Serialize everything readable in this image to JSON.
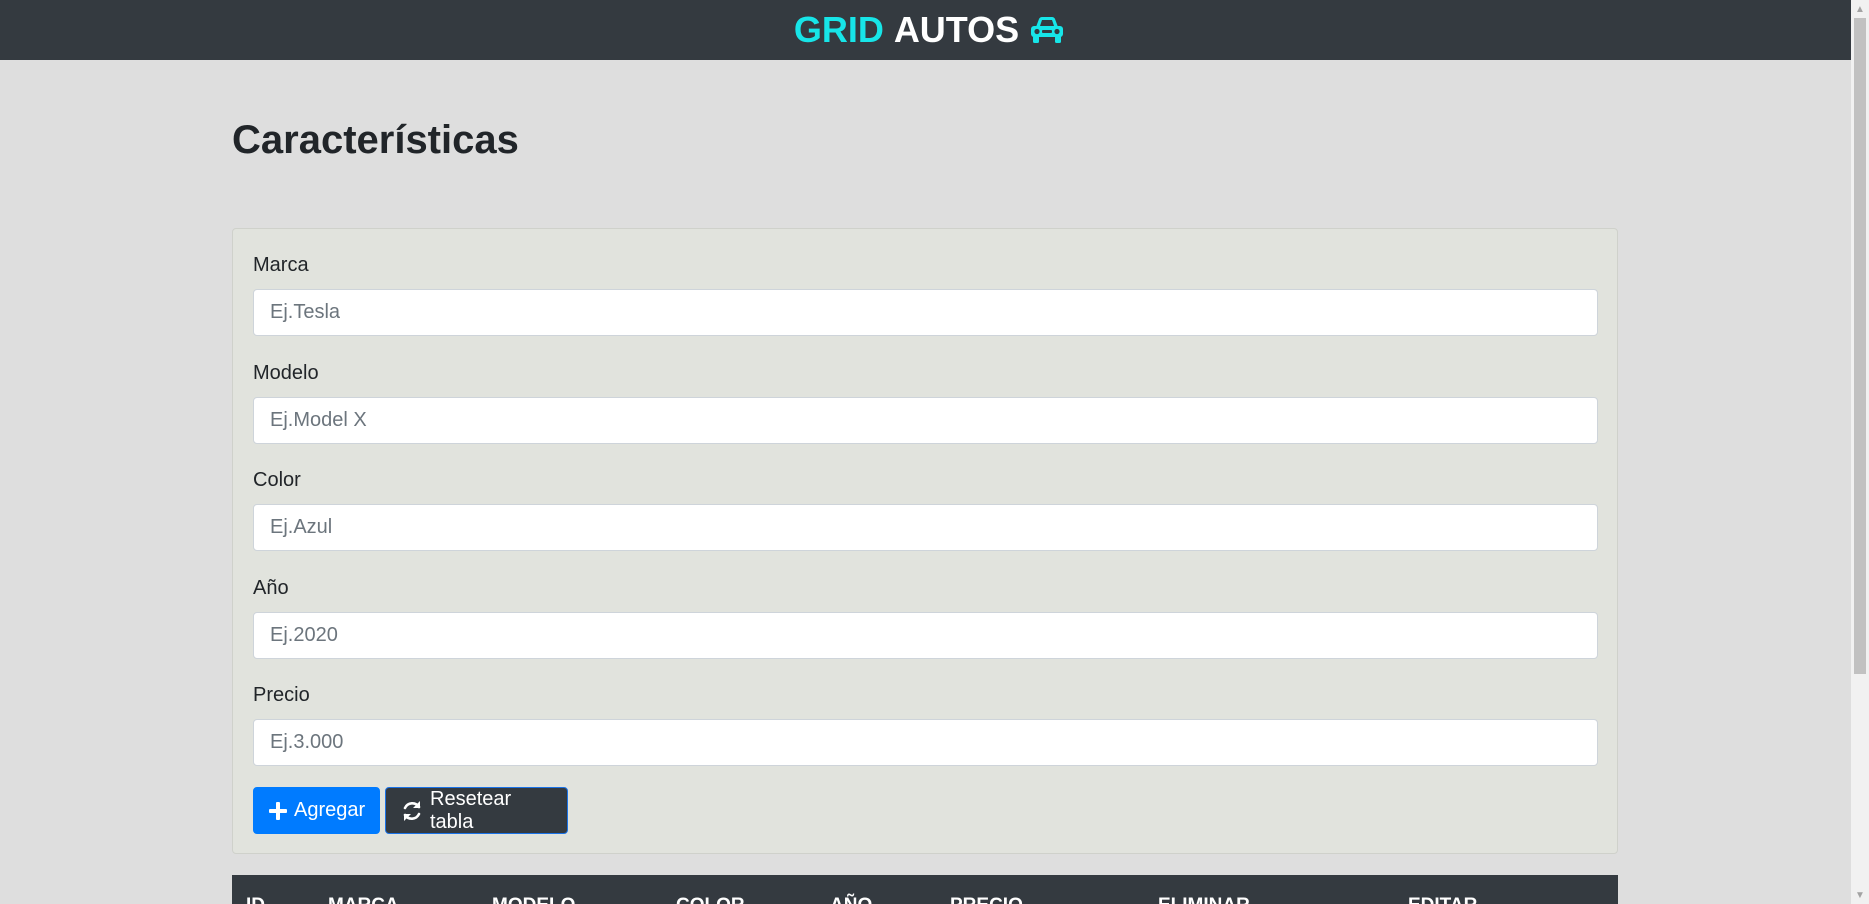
{
  "navbar": {
    "brand_part1": "GRID",
    "brand_part2": "AUTOS",
    "brand_icon": "car-icon",
    "accent_color": "#17e5e8",
    "background_color": "#343a40"
  },
  "main": {
    "title": "Características"
  },
  "form": {
    "fields": [
      {
        "label": "Marca",
        "placeholder": "Ej.Tesla",
        "value": ""
      },
      {
        "label": "Modelo",
        "placeholder": "Ej.Model X",
        "value": ""
      },
      {
        "label": "Color",
        "placeholder": "Ej.Azul",
        "value": ""
      },
      {
        "label": "Año",
        "placeholder": "Ej.2020",
        "value": ""
      },
      {
        "label": "Precio",
        "placeholder": "Ej.3.000",
        "value": ""
      }
    ],
    "add_button": {
      "label": "Agregar",
      "icon": "plus-icon",
      "color": "#007bff"
    },
    "reset_button": {
      "label": "Resetear tabla",
      "icon": "refresh-icon",
      "color": "#343a40"
    }
  },
  "table": {
    "headers": [
      "ID",
      "MARCA",
      "MODELO",
      "COLOR",
      "AÑO",
      "PRECIO",
      "ELIMINAR",
      "EDITAR"
    ]
  }
}
